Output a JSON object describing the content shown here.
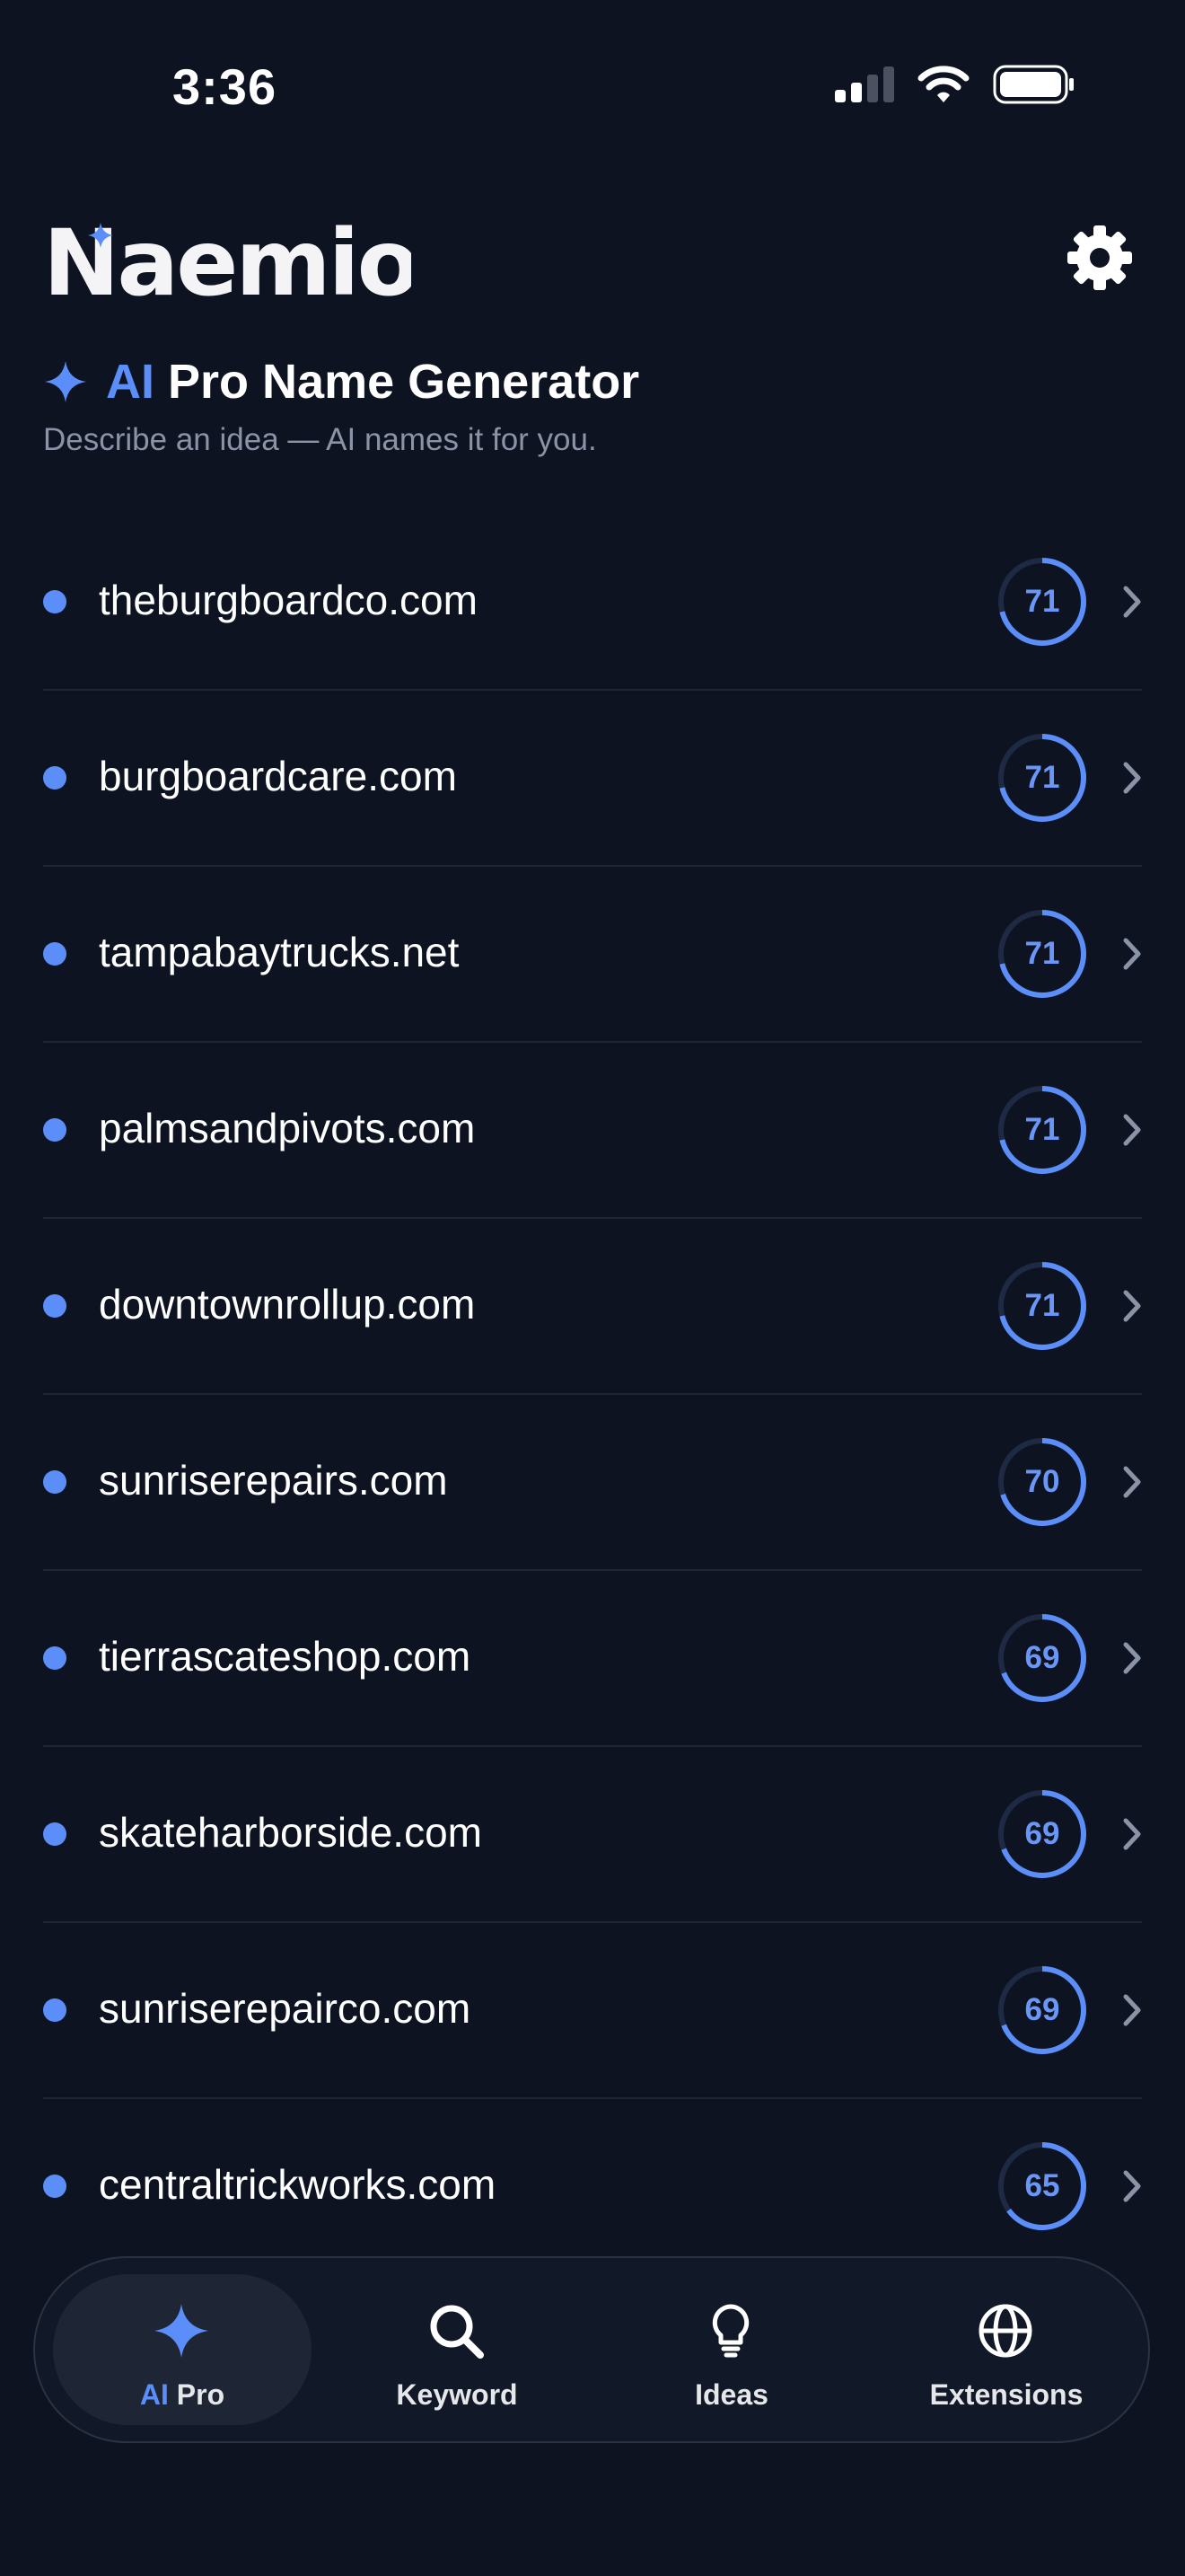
{
  "status_bar": {
    "time": "3:36"
  },
  "header": {
    "logo_text": "Naemio"
  },
  "title": {
    "accent": "AI",
    "rest": "Pro Name Generator",
    "subtitle": "Describe an idea — AI names it for you."
  },
  "accent_color": "#5b8ef8",
  "results": [
    {
      "domain": "theburgboardco.com",
      "score": "71"
    },
    {
      "domain": "burgboardcare.com",
      "score": "71"
    },
    {
      "domain": "tampabaytrucks.net",
      "score": "71"
    },
    {
      "domain": "palmsandpivots.com",
      "score": "71"
    },
    {
      "domain": "downtownrollup.com",
      "score": "71"
    },
    {
      "domain": "sunriserepairs.com",
      "score": "70"
    },
    {
      "domain": "tierrascateshop.com",
      "score": "69"
    },
    {
      "domain": "skateharborside.com",
      "score": "69"
    },
    {
      "domain": "sunriserepairco.com",
      "score": "69"
    },
    {
      "domain": "centraltrickworks.com",
      "score": "65"
    }
  ],
  "tabs": {
    "ai_pro": {
      "accent": "AI",
      "rest": "Pro",
      "icon": "sparkle-icon"
    },
    "keyword": {
      "label": "Keyword",
      "icon": "search-icon"
    },
    "ideas": {
      "label": "Ideas",
      "icon": "lightbulb-icon"
    },
    "extensions": {
      "label": "Extensions",
      "icon": "globe-icon"
    }
  }
}
